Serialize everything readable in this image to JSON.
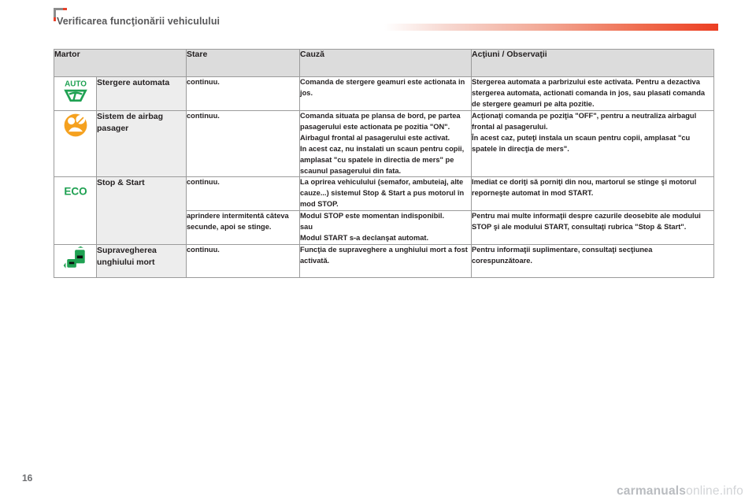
{
  "header": {
    "title": "Verificarea funcţionării vehiculului",
    "accent_color": "#e8412a",
    "rule_color": "#ec3e22"
  },
  "table": {
    "columns": [
      {
        "key": "martor",
        "label": "Martor"
      },
      {
        "key": "stare",
        "label": "Stare"
      },
      {
        "key": "cauza",
        "label": "Cauză"
      },
      {
        "key": "actiuni",
        "label": "Acţiuni / Observaţii"
      }
    ],
    "rows": [
      {
        "icon": "auto-wiper-icon",
        "icon_color": "#1fa152",
        "icon_label": "AUTO",
        "name": "Stergere automata",
        "stare": "continuu.",
        "cauza": "Comanda de stergere geamuri este actionata in jos.",
        "actiuni": "Stergerea automata a parbrizului este activata. Pentru a dezactiva stergerea automata, actionati comanda in jos, sau plasati comanda de stergere geamuri pe alta pozitie."
      },
      {
        "icon": "passenger-airbag-icon",
        "icon_color": "#f5a11f",
        "icon_label": "",
        "name": "Sistem de airbag pasager",
        "stare": "continuu.",
        "cauza": "Comanda situata pe plansa de bord, pe partea pasagerului este actionata pe pozitia \"ON\".\nAirbagul frontal al pasagerului este activat.\nIn acest caz, nu instalati un scaun pentru copii, amplasat \"cu spatele in directia de mers\" pe scaunul pasagerului din fata.",
        "actiuni": "Acţionaţi comanda pe poziţia \"OFF\", pentru a neutraliza airbagul frontal al pasagerului.\nÎn acest caz, puteţi instala un scaun pentru copii, amplasat \"cu spatele în direcţia de mers\"."
      },
      {
        "icon": "eco-stop-start-icon",
        "icon_color": "#1fa152",
        "icon_label": "ECO",
        "name": "Stop & Start",
        "stare": "continuu.",
        "cauza": "La oprirea vehiculului (semafor, ambuteiaj, alte cauze...) sistemul Stop & Start a pus motorul în mod STOP.",
        "actiuni": "Imediat ce doriţi să porniţi din nou, martorul se stinge şi motorul reporneşte automat în mod START."
      },
      {
        "icon": "",
        "icon_color": "",
        "icon_label": "",
        "name": "",
        "stare": "aprindere intermitentă câteva secunde, apoi se stinge.",
        "cauza": "Modul STOP este momentan indisponibil.\nsau\nModul START s-a declanşat automat.",
        "actiuni": "Pentru mai multe informaţii despre cazurile deosebite ale modului STOP şi ale modului START, consultaţi rubrica \"Stop & Start\"."
      },
      {
        "icon": "blind-spot-monitor-icon",
        "icon_color": "#1fa152",
        "icon_label": "",
        "name": "Supravegherea unghiului mort",
        "stare": "continuu.",
        "cauza": "Funcţia de supraveghere a unghiului mort a fost activată.",
        "actiuni": "Pentru informaţii suplimentare, consultaţi secţiunea corespunzătoare."
      }
    ]
  },
  "footer": {
    "page_number": "16",
    "watermark_bold": "carmanuals",
    "watermark_light": "online.info"
  }
}
